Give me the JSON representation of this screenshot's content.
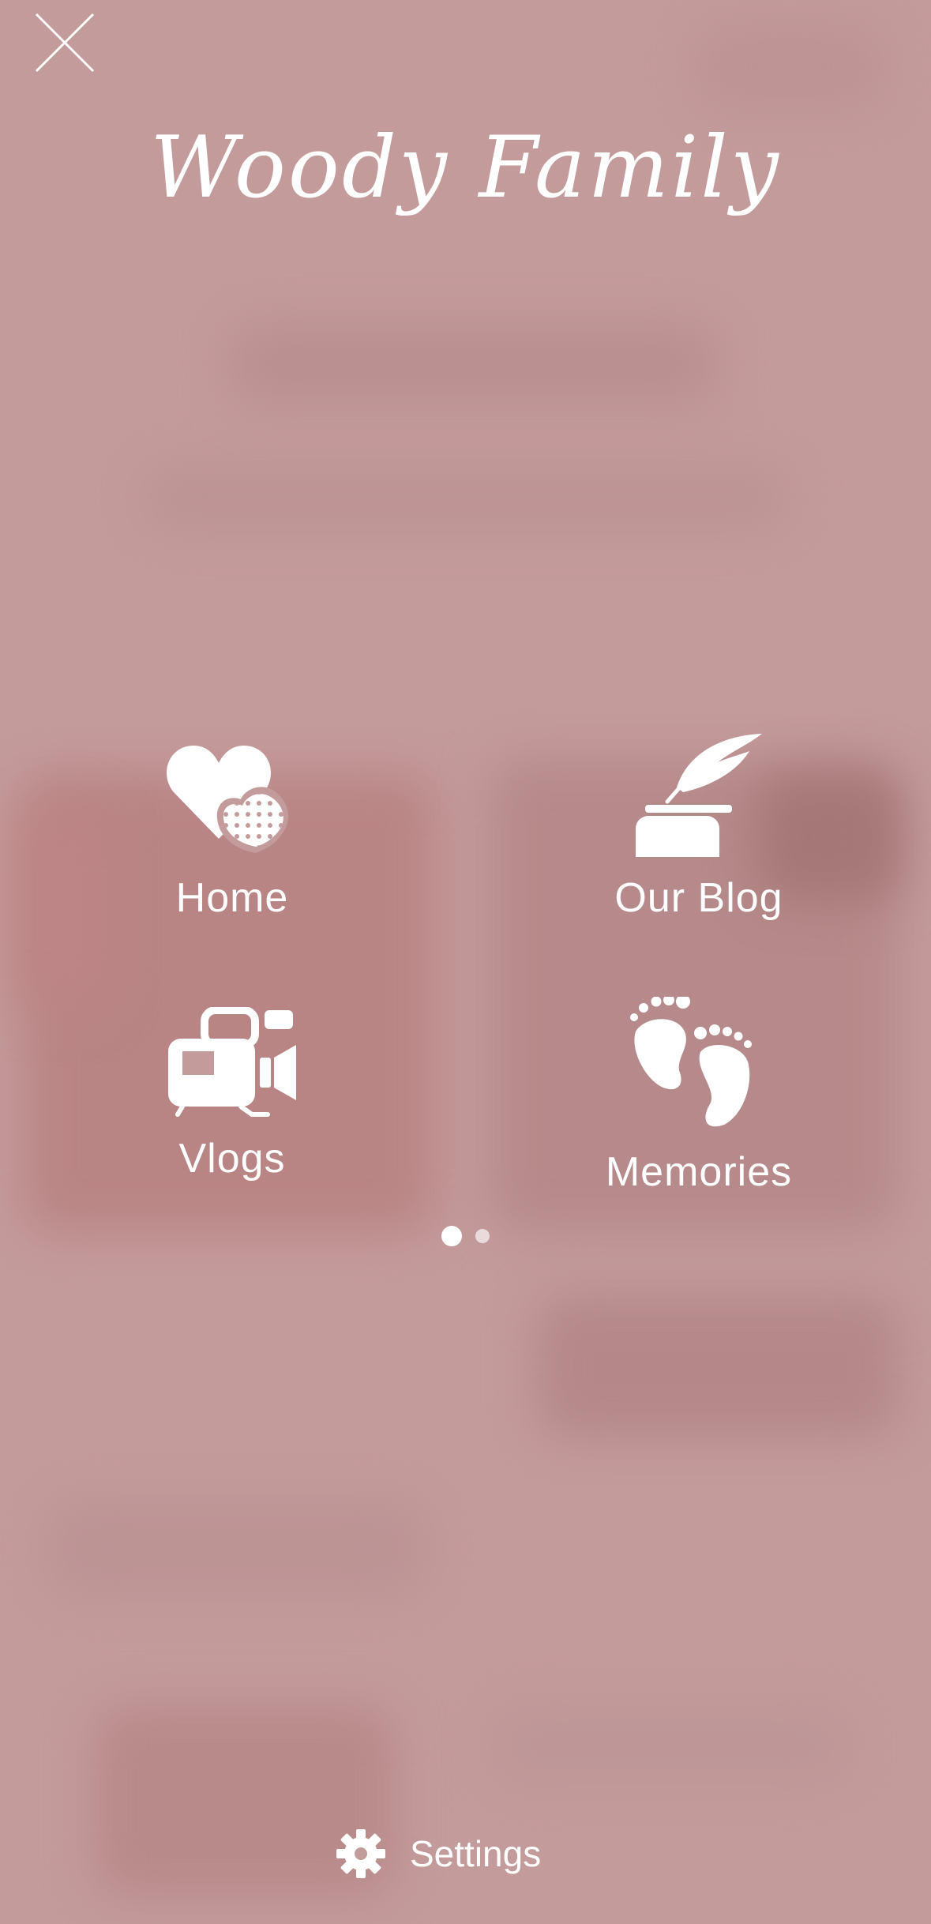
{
  "app": {
    "title": "Woody Family"
  },
  "menu": {
    "items": [
      {
        "label": "Home",
        "icon": "hearts-icon"
      },
      {
        "label": "Our Blog",
        "icon": "quill-inkwell-icon"
      },
      {
        "label": "Vlogs",
        "icon": "video-camera-icon"
      },
      {
        "label": "Memories",
        "icon": "footprints-icon"
      }
    ],
    "pages": {
      "count": 2,
      "current": 1
    }
  },
  "footer": {
    "settings_label": "Settings",
    "settings_icon": "gear-icon"
  },
  "colors": {
    "background": "#c49b9b",
    "foreground": "#ffffff"
  }
}
